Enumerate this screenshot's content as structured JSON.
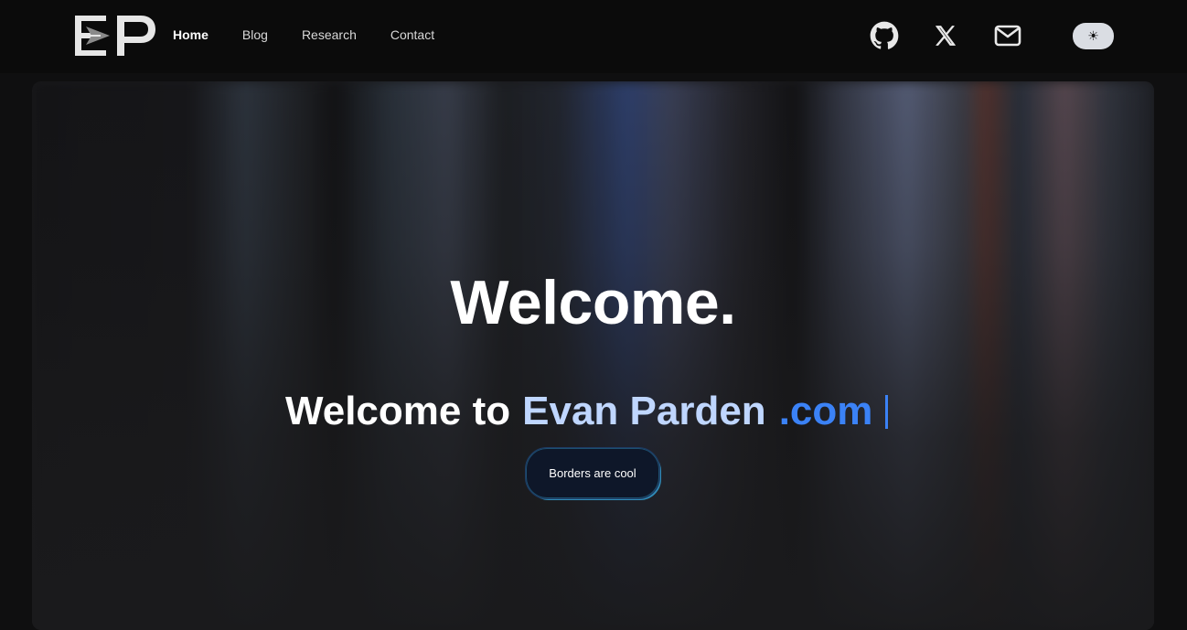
{
  "nav": {
    "logo_alt": "EP",
    "links": [
      {
        "label": "Home",
        "active": true
      },
      {
        "label": "Blog",
        "active": false
      },
      {
        "label": "Research",
        "active": false
      },
      {
        "label": "Contact",
        "active": false
      }
    ],
    "social": [
      {
        "name": "github-icon"
      },
      {
        "name": "x-icon"
      },
      {
        "name": "mail-icon"
      }
    ],
    "theme_toggle": "☀"
  },
  "hero": {
    "title": "Welcome.",
    "subtitle_prefix": "Welcome to",
    "subtitle_name": "Evan Parden",
    "subtitle_suffix": ".com",
    "cta_label": "Borders are cool"
  },
  "colors": {
    "accent_blue": "#3b82f6",
    "accent_light": "#bfd6ff",
    "toggle_bg": "#dadde3"
  }
}
